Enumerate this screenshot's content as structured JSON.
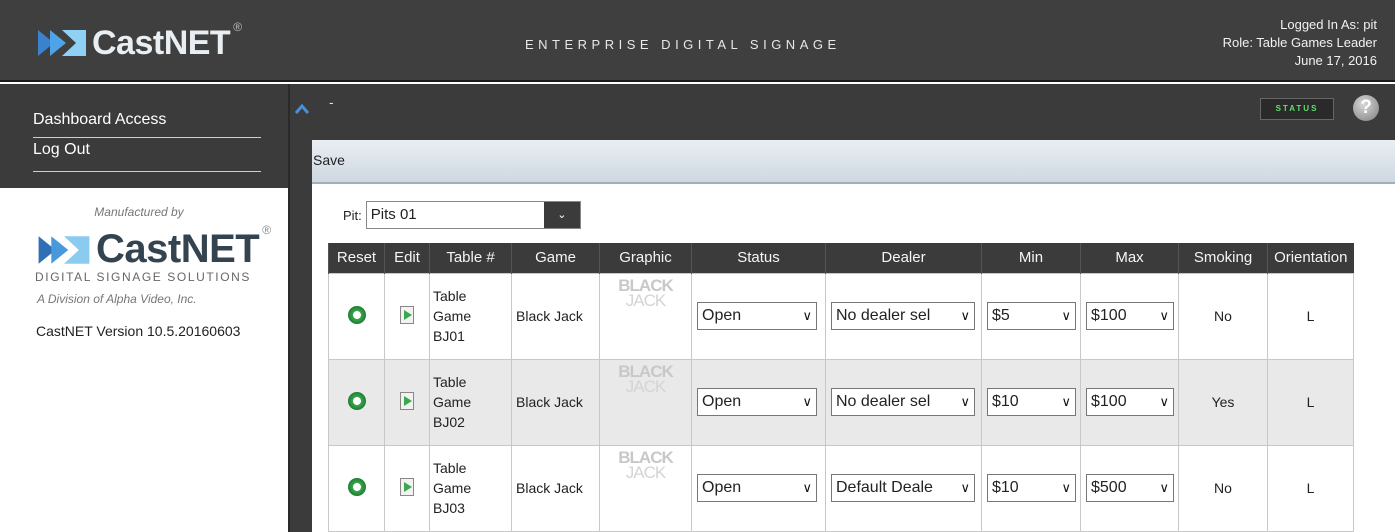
{
  "header": {
    "logo_text": "CastNET",
    "logo_reg": "®",
    "tagline": "ENTERPRISE DIGITAL SIGNAGE",
    "logged_in": "Logged In As: pit",
    "role": "Role: Table Games Leader",
    "date": "June 17, 2016"
  },
  "sidebar": {
    "items": [
      {
        "label": "Dashboard Access"
      },
      {
        "label": "Log Out"
      }
    ],
    "manufactured_by": "Manufactured by",
    "logo_text": "CastNET",
    "logo_reg": "®",
    "dss": "DIGITAL SIGNAGE SOLUTIONS",
    "division": "A Division of Alpha Video, Inc.",
    "version": "CastNET Version 10.5.20160603"
  },
  "toolbar": {
    "title": "-",
    "status_label": "STATUS",
    "help_label": "?",
    "save_label": "Save"
  },
  "pit": {
    "label": "Pit:",
    "value": "Pits 01",
    "arrow": "⌄"
  },
  "table": {
    "headers": [
      "Reset",
      "Edit",
      "Table #",
      "Game",
      "Graphic",
      "Status",
      "Dealer",
      "Min",
      "Max",
      "Smoking",
      "Orientation"
    ],
    "graphic_top": "BLACK",
    "graphic_bottom": "JACK",
    "rows": [
      {
        "table_line1": "Table",
        "table_line2": "Game",
        "table_line3": "BJ01",
        "game": "Black Jack",
        "status": "Open",
        "dealer": "No dealer sel",
        "min": "$5",
        "max": "$100",
        "smoking": "No",
        "orientation": "L"
      },
      {
        "table_line1": "Table",
        "table_line2": "Game",
        "table_line3": "BJ02",
        "game": "Black Jack",
        "status": "Open",
        "dealer": "No dealer sel",
        "min": "$10",
        "max": "$100",
        "smoking": "Yes",
        "orientation": "L"
      },
      {
        "table_line1": "Table",
        "table_line2": "Game",
        "table_line3": "BJ03",
        "game": "Black Jack",
        "status": "Open",
        "dealer": "Default Deale",
        "min": "$10",
        "max": "$500",
        "smoking": "No",
        "orientation": "L"
      }
    ]
  },
  "colors": {
    "header_bg": "#3f3f3f",
    "panel_bg": "#3b3b3b",
    "status_green": "#5ee06a",
    "icon_green": "#3aa84c",
    "collapse_blue": "#4a90d9"
  },
  "icons": {
    "logo": "castnet-logo-icon",
    "collapse": "chevron-up-icon",
    "help": "help-icon",
    "reset": "refresh-icon",
    "edit": "edit-icon",
    "dropdown": "chevron-down-icon"
  }
}
